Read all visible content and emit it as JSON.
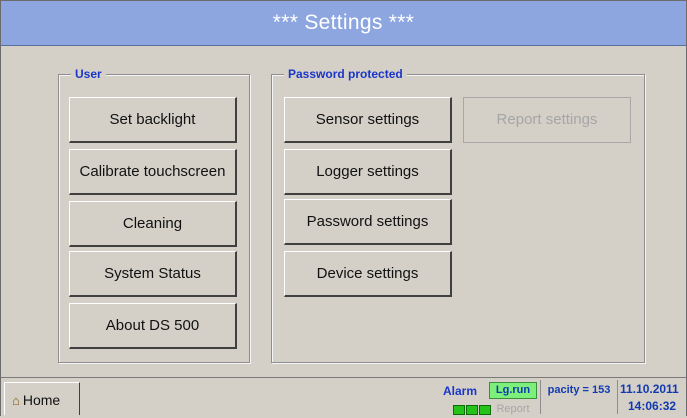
{
  "header": {
    "title": "***  Settings  ***"
  },
  "user_group": {
    "label": "User",
    "buttons": [
      "Set backlight",
      "Calibrate touchscreen",
      "Cleaning",
      "System Status",
      "About DS 500"
    ]
  },
  "password_group": {
    "label": "Password protected",
    "buttons": [
      "Sensor settings",
      "Logger settings",
      "Password settings",
      "Device settings"
    ],
    "report_button": "Report settings"
  },
  "statusbar": {
    "home_label": "Home",
    "home_icon": "home-icon",
    "alarm_label": "Alarm",
    "logger_status": "Lg.run",
    "report_status": "Report",
    "capacity": "pacity = 153",
    "date": "11.10.2011",
    "time": "14:06:32"
  },
  "colors": {
    "title_bg": "#8da6e0",
    "group_label": "#1a36c9",
    "logger_run_bg": "#7cf07a",
    "alarm_led": "#25c21a"
  }
}
